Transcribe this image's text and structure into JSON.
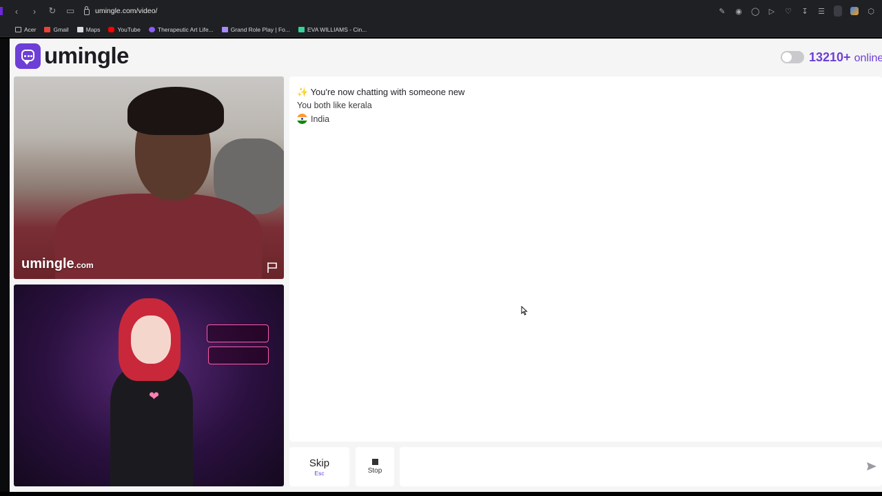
{
  "browser": {
    "url": "umingle.com/video/",
    "bookmarks": [
      "Acer",
      "Gmail",
      "Maps",
      "YouTube",
      "Therapeutic Art Life...",
      "Grand Role Play | Fo...",
      "EVA WILLIAMS - Cin..."
    ]
  },
  "header": {
    "logo_text": "umingle",
    "online_count": "13210+",
    "online_label": "online"
  },
  "video": {
    "watermark_main": "umingle",
    "watermark_suffix": ".com"
  },
  "chat": {
    "line1_emoji": "✨",
    "line1": "You're now chatting with someone new",
    "line2": "You both like kerala",
    "country": "India"
  },
  "controls": {
    "skip_label": "Skip",
    "skip_key": "Esc",
    "stop_label": "Stop",
    "message_placeholder": ""
  },
  "colors": {
    "brand": "#6d3fd6",
    "page_bg": "#f5f5f6"
  }
}
